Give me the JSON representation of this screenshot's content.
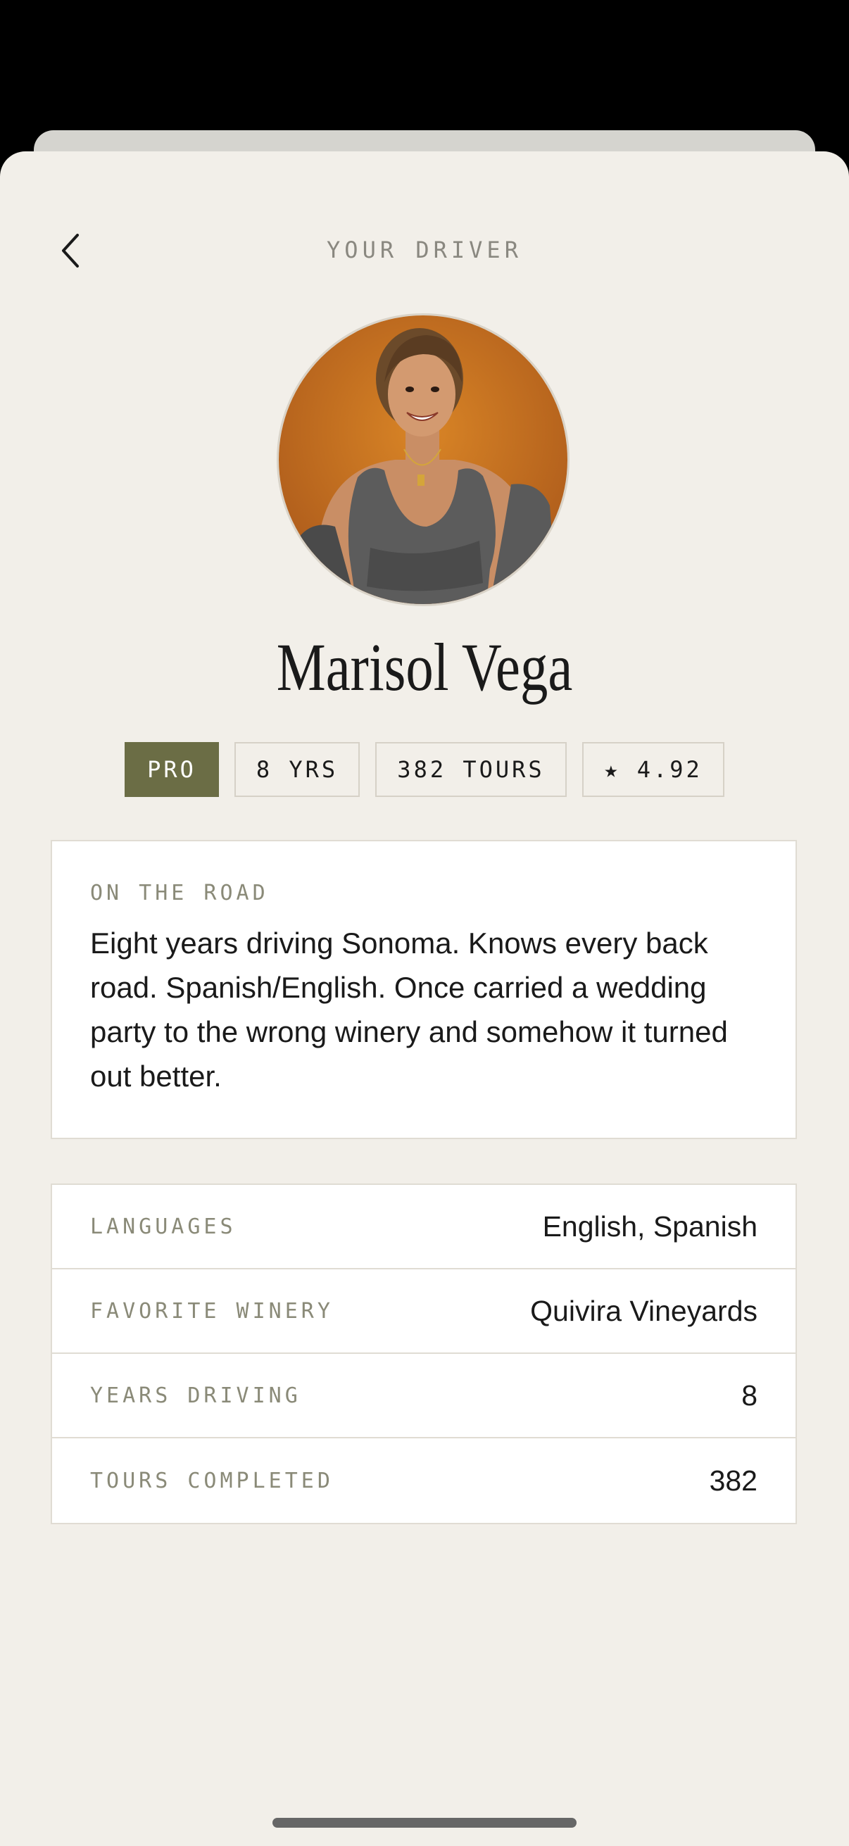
{
  "header": {
    "title": "YOUR DRIVER"
  },
  "driver": {
    "name": "Marisol Vega",
    "badges": {
      "pro": "PRO",
      "years": "8 YRS",
      "tours": "382 TOURS",
      "rating": "★ 4.92"
    }
  },
  "about": {
    "label": "ON THE ROAD",
    "text": "Eight years driving Sonoma. Knows every back road. Spanish/English. Once carried a wedding party to the wrong winery and somehow it turned out better."
  },
  "stats": [
    {
      "label": "LANGUAGES",
      "value": "English, Spanish"
    },
    {
      "label": "FAVORITE WINERY",
      "value": "Quivira Vineyards"
    },
    {
      "label": "YEARS DRIVING",
      "value": "8"
    },
    {
      "label": "TOURS COMPLETED",
      "value": "382"
    }
  ],
  "colors": {
    "background": "#f2efe9",
    "accent": "#6b6d45",
    "card": "#ffffff",
    "muted_text": "#8a8a78"
  },
  "icons": {
    "back": "chevron-left-icon"
  }
}
